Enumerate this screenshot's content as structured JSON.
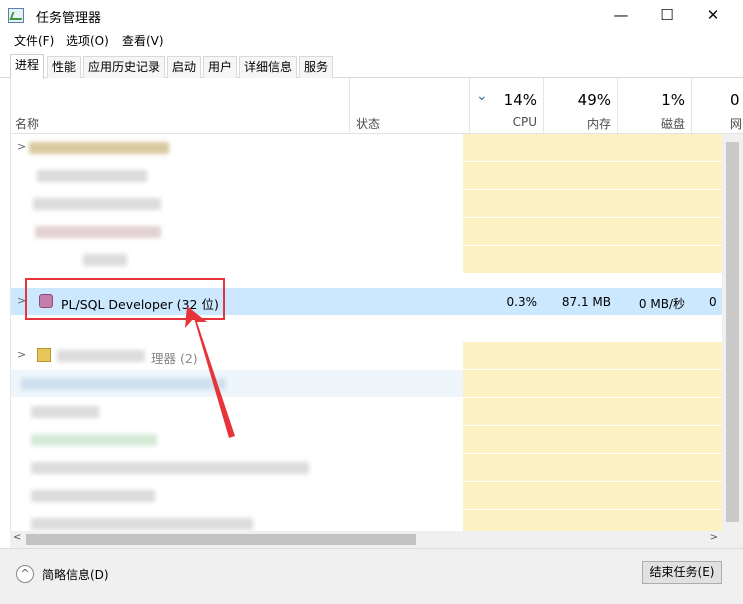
{
  "window": {
    "title": "任务管理器",
    "minimize": "—",
    "maximize": "☐",
    "close": "✕"
  },
  "menu": [
    "文件(F)",
    "选项(O)",
    "查看(V)"
  ],
  "tabs": [
    {
      "label": "进程",
      "active": true
    },
    {
      "label": "性能",
      "active": false
    },
    {
      "label": "应用历史记录",
      "active": false
    },
    {
      "label": "启动",
      "active": false
    },
    {
      "label": "用户",
      "active": false
    },
    {
      "label": "详细信息",
      "active": false
    },
    {
      "label": "服务",
      "active": false
    }
  ],
  "header": {
    "name_label": "名称",
    "status_label": "状态",
    "sort_arrow": "⌄",
    "cpu": {
      "pct": "14%",
      "label": "CPU"
    },
    "mem": {
      "pct": "49%",
      "label": "内存"
    },
    "disk": {
      "pct": "1%",
      "label": "磁盘"
    },
    "net": {
      "pct": "0",
      "label": "网"
    }
  },
  "selected_row": {
    "name": "PL/SQL Developer (32 位)",
    "cpu": "0.3%",
    "memory": "87.1 MB",
    "disk": "0 MB/秒",
    "network": "0"
  },
  "partial_row_text": "理器 (2)",
  "footer": {
    "toggle": "^",
    "label": "简略信息(D)",
    "end_task": "结束任务(E)"
  },
  "colors": {
    "heat": "#fbf1c3",
    "selection": "#cce8ff",
    "annotation": "#e6343a"
  }
}
